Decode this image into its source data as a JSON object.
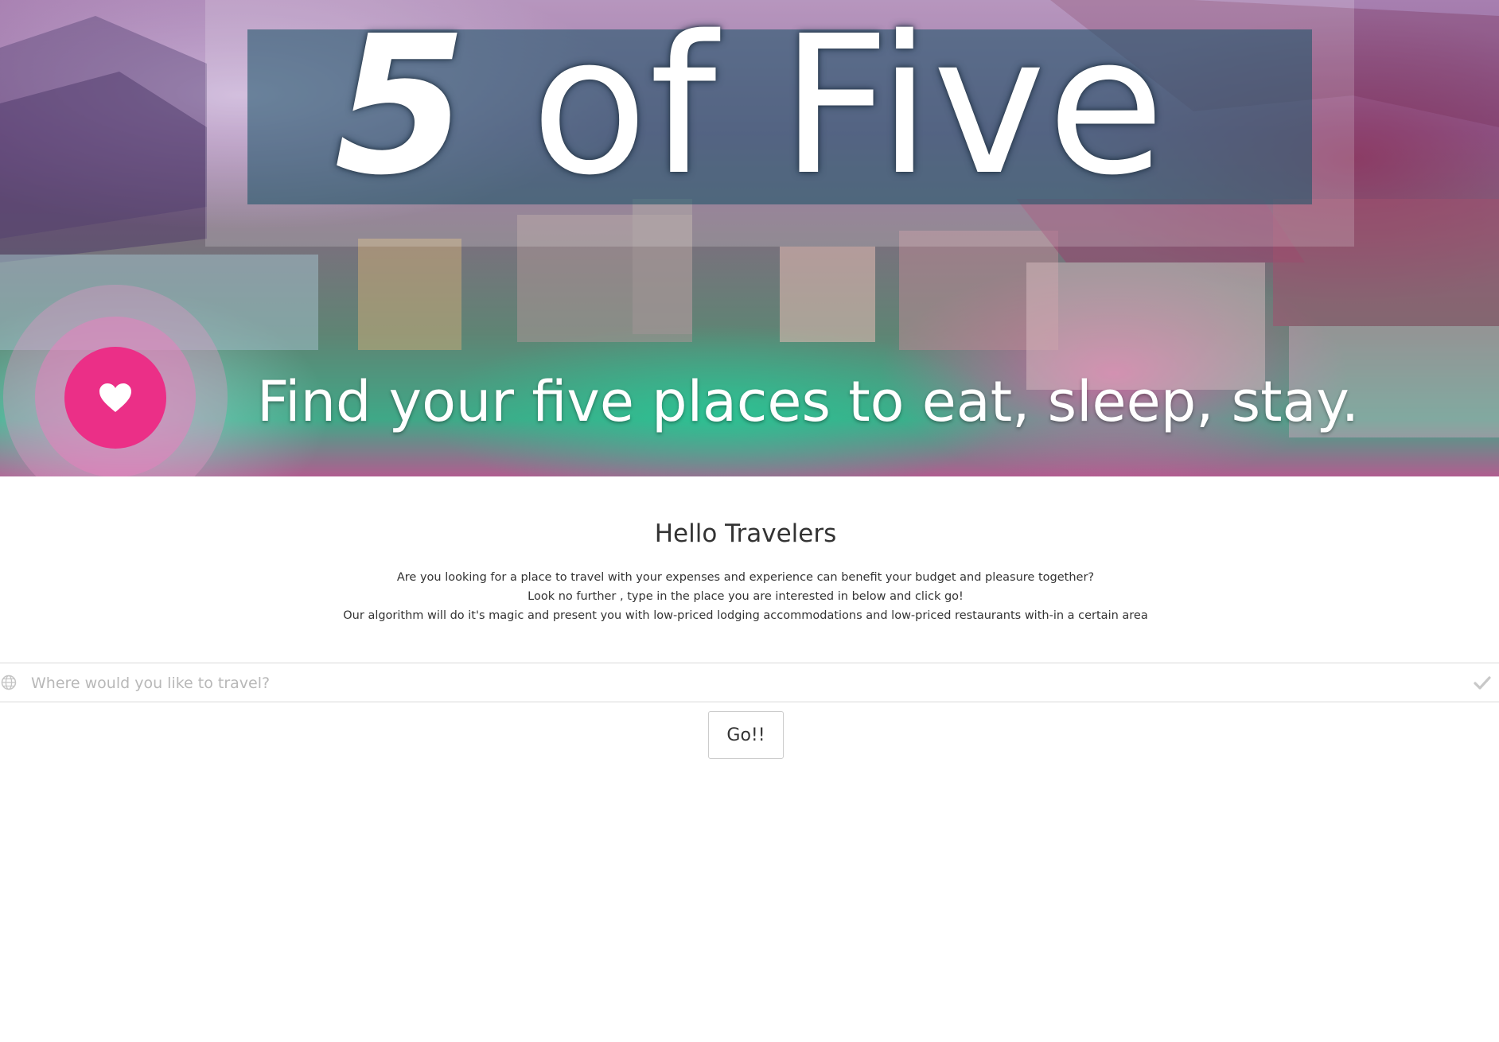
{
  "hero": {
    "title_number": "5",
    "title_rest": "of Five",
    "tagline": "Find your five places to eat, sleep, stay.",
    "favorite_icon": "heart-icon"
  },
  "intro": {
    "heading": "Hello Travelers",
    "lines": [
      "Are you looking for a place to travel with your expenses and experience can benefit your budget and pleasure together?",
      "Look no further , type in the place you are interested in below and click go!",
      "Our algorithm will do it's magic and present you with low-priced lodging accommodations and low-priced restaurants with-in a certain area"
    ]
  },
  "search": {
    "placeholder": "Where would you like to travel?",
    "value": "",
    "leading_icon": "globe-icon",
    "trailing_icon": "check-icon"
  },
  "go_button": {
    "label": "Go!!"
  },
  "colors": {
    "accent_pink": "#eb2f87",
    "text": "#333333",
    "placeholder": "#b8b8b8"
  }
}
